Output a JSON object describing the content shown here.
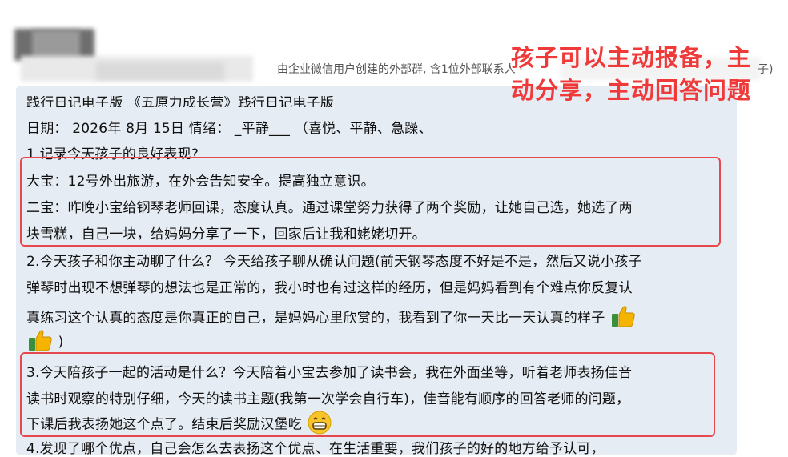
{
  "header": {
    "group_info": "由企业微信用户创建的外部群, 含1位外部联系人 · ",
    "group_info_end": "子)"
  },
  "annotation": {
    "text": "孩子可以主动报备，主动分享，主动回答问题"
  },
  "message": {
    "title_line": "践行日记电子版 《五原力成长营》践行日记电子版",
    "date_line": "日期： 2026年 8月 15日  情绪：  _平静___  （喜悦、平静、急躁、",
    "q1": "1.记录今天孩子的良好表现?",
    "dabao": "大宝：12号外出旅游，在外会告知安全。提高独立意识。",
    "erbao_1": "二宝：昨晚小宝给钢琴老师回课，态度认真。通过课堂努力获得了两个奖励，让她自己选，她选了两",
    "erbao_2": "块雪糕，自己一块，给妈妈分享了一下，回家后让我和姥姥切开。",
    "q2_1": "2.今天孩子和你主动聊了什么？  今天给孩子聊从确认问题(前天钢琴态度不好是不是，然后又说小孩子",
    "q2_2": "弹琴时出现不想弹琴的想法也是正常的，我小时也有过这样的经历，但是妈妈看到有个难点你反复认",
    "q2_3": "真练习这个认真的态度是你真正的自己，是妈妈心里欣赏的，我看到了你一天比一天认真的样子",
    "q2_4": ")",
    "q3_1": "3.今天陪孩子一起的活动是什么？今天陪着小宝去参加了读书会，我在外面坐等，听着老师表扬佳音",
    "q3_2": "读书时观察的特别仔细，今天的读书主题(我第一次学会自行车)，佳音能有顺序的回答老师的问题，",
    "q3_3": "下课后我表扬她这个点了。结束后奖励汉堡吃",
    "q4_partial": "4.发现了哪个优点，自己会怎么去表扬这个优点、在生活重要，我们孩子的好的地方给予认可，"
  },
  "icons": [
    "thumbs-up-icon",
    "grinning-face-icon"
  ],
  "colors": {
    "highlight": "#e5484d",
    "bubble": "#e6ecf3",
    "annotation": "#f03a3a"
  }
}
